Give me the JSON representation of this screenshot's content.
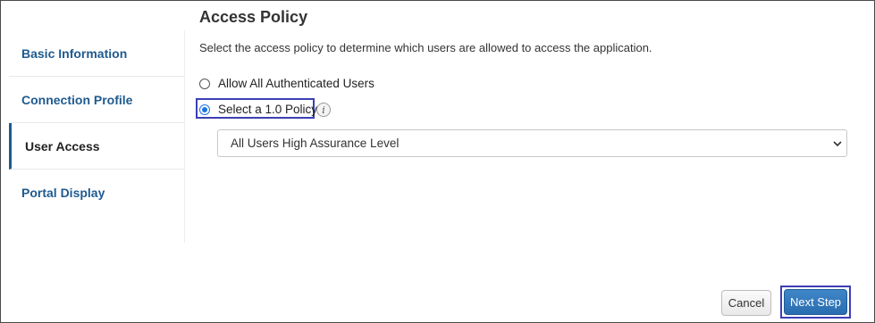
{
  "sidebar": {
    "items": [
      {
        "label": "Basic Information"
      },
      {
        "label": "Connection Profile"
      },
      {
        "label": "User Access",
        "active": true
      },
      {
        "label": "Portal Display"
      }
    ]
  },
  "main": {
    "title": "Access Policy",
    "description": "Select the access policy to determine which users are allowed to access the application.",
    "options": [
      {
        "label": "Allow All Authenticated Users",
        "selected": false
      },
      {
        "label": "Select a 1.0 Policy",
        "selected": true
      }
    ],
    "info_icon": "i",
    "policy_select": {
      "value": "All Users High Assurance Level"
    }
  },
  "footer": {
    "cancel_label": "Cancel",
    "next_label": "Next Step"
  },
  "colors": {
    "link": "#1f5a8f",
    "primary_button": "#2f76bb",
    "highlight": "#3b3fb5",
    "radio_selected": "#1a73e8"
  }
}
